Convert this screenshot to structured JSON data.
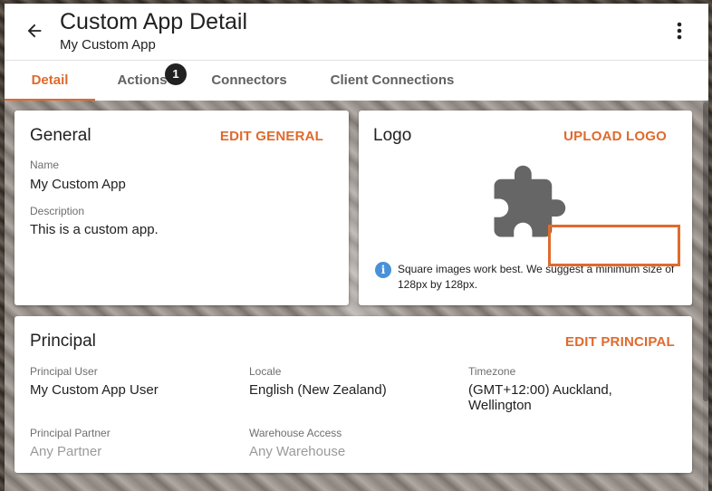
{
  "header": {
    "title": "Custom App Detail",
    "subtitle": "My Custom App"
  },
  "tabs": [
    {
      "label": "Detail",
      "active": true
    },
    {
      "label": "Actions",
      "badge": "1"
    },
    {
      "label": "Connectors"
    },
    {
      "label": "Client Connections"
    }
  ],
  "general": {
    "title": "General",
    "action": "EDIT GENERAL",
    "name_label": "Name",
    "name_value": "My Custom App",
    "description_label": "Description",
    "description_value": "This is a custom app."
  },
  "logo": {
    "title": "Logo",
    "action": "UPLOAD LOGO",
    "placeholder_icon": "puzzle-piece-icon",
    "info_text": "Square images work best. We suggest a minimum size of 128px by 128px."
  },
  "principal": {
    "title": "Principal",
    "action": "EDIT PRINCIPAL",
    "user_label": "Principal User",
    "user_value": "My Custom App User",
    "locale_label": "Locale",
    "locale_value": "English (New Zealand)",
    "timezone_label": "Timezone",
    "timezone_value": "(GMT+12:00) Auckland, Wellington",
    "partner_label": "Principal Partner",
    "partner_value": "Any Partner",
    "warehouse_label": "Warehouse Access",
    "warehouse_value": "Any Warehouse"
  },
  "colors": {
    "accent": "#e06a2c",
    "info": "#4a90d9",
    "placeholder_icon": "#666666"
  }
}
